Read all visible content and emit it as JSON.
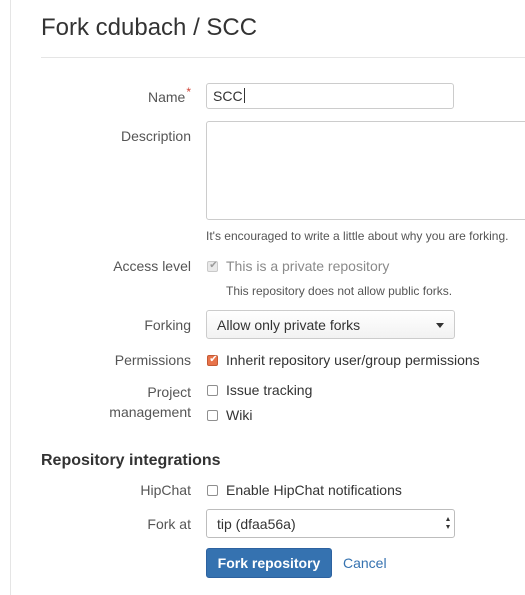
{
  "page": {
    "title": "Fork cdubach / SCC"
  },
  "form": {
    "name": {
      "label": "Name",
      "required_mark": "*",
      "value": "SCC"
    },
    "description": {
      "label": "Description",
      "value": "",
      "help": "It's encouraged to write a little about why you are forking."
    },
    "access_level": {
      "label": "Access level",
      "checkbox_label": "This is a private repository",
      "checked": true,
      "disabled": true,
      "help": "This repository does not allow public forks."
    },
    "forking": {
      "label": "Forking",
      "selected": "Allow only private forks"
    },
    "permissions": {
      "label": "Permissions",
      "checkbox_label": "Inherit repository user/group permissions",
      "checked": true
    },
    "project_management": {
      "label_line1": "Project",
      "label_line2": "management",
      "options": [
        {
          "label": "Issue tracking",
          "checked": false
        },
        {
          "label": "Wiki",
          "checked": false
        }
      ]
    }
  },
  "integrations": {
    "heading": "Repository integrations",
    "hipchat": {
      "label": "HipChat",
      "checkbox_label": "Enable HipChat notifications",
      "checked": false
    },
    "fork_at": {
      "label": "Fork at",
      "selected": "tip (dfaa56a)"
    }
  },
  "actions": {
    "submit": "Fork repository",
    "cancel": "Cancel"
  },
  "colors": {
    "primary": "#3572b0",
    "required": "#d04437",
    "checkbox_checked": "#e8734a",
    "link": "#3572b0"
  }
}
